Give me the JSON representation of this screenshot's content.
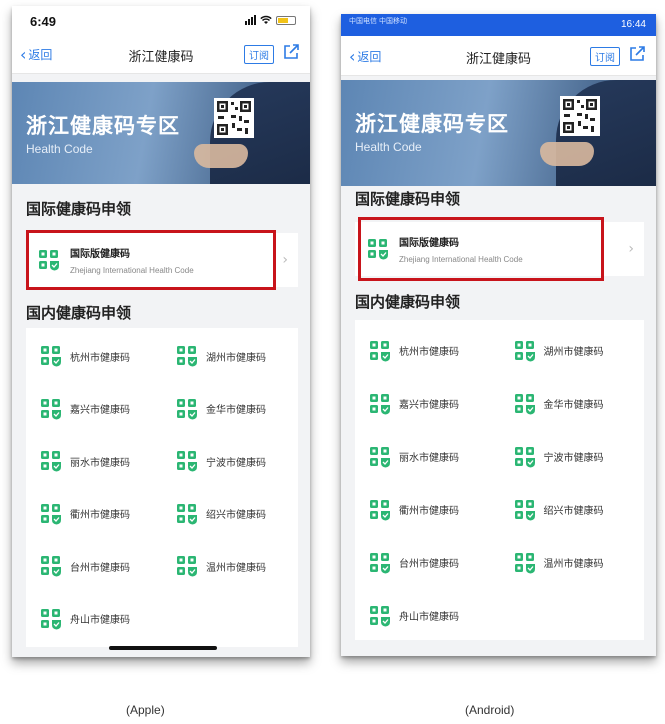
{
  "apple": {
    "status_time": "6:49",
    "nav": {
      "back": "返回",
      "title": "浙江健康码",
      "subscribe": "订阅"
    },
    "banner": {
      "heading": "浙江健康码专区",
      "sub": "Health Code"
    },
    "intl_section_title": "国际健康码申领",
    "intl_card": {
      "name": "国际版健康码",
      "en": "Zhejiang International Health Code"
    },
    "domestic_section_title": "国内健康码申领",
    "cities": [
      "杭州市健康码",
      "湖州市健康码",
      "嘉兴市健康码",
      "金华市健康码",
      "丽水市健康码",
      "宁波市健康码",
      "衢州市健康码",
      "绍兴市健康码",
      "台州市健康码",
      "温州市健康码",
      "舟山市健康码"
    ],
    "caption": "(Apple)"
  },
  "android": {
    "status_left": "中国电信 中国移动",
    "status_right": "16:44",
    "nav": {
      "back": "返回",
      "title": "浙江健康码",
      "subscribe": "订阅"
    },
    "banner": {
      "heading": "浙江健康码专区",
      "sub": "Health Code"
    },
    "intl_section_title": "国际健康码申领",
    "intl_card": {
      "name": "国际版健康码",
      "en": "Zhejiang International Health Code"
    },
    "domestic_section_title": "国内健康码申领",
    "cities": [
      "杭州市健康码",
      "湖州市健康码",
      "嘉兴市健康码",
      "金华市健康码",
      "丽水市健康码",
      "宁波市健康码",
      "衢州市健康码",
      "绍兴市健康码",
      "台州市健康码",
      "温州市健康码",
      "舟山市健康码"
    ],
    "caption": "(Android)"
  },
  "colors": {
    "accent": "#2d7be5",
    "highlight": "#c8141b",
    "icon_green": "#2bb673",
    "android_status": "#1e5fe0"
  },
  "icons": {
    "city": "health-code-icon",
    "qr": "qr-code-icon",
    "share": "share-icon",
    "back": "chevron-left-icon",
    "arrow": "chevron-right-icon"
  }
}
